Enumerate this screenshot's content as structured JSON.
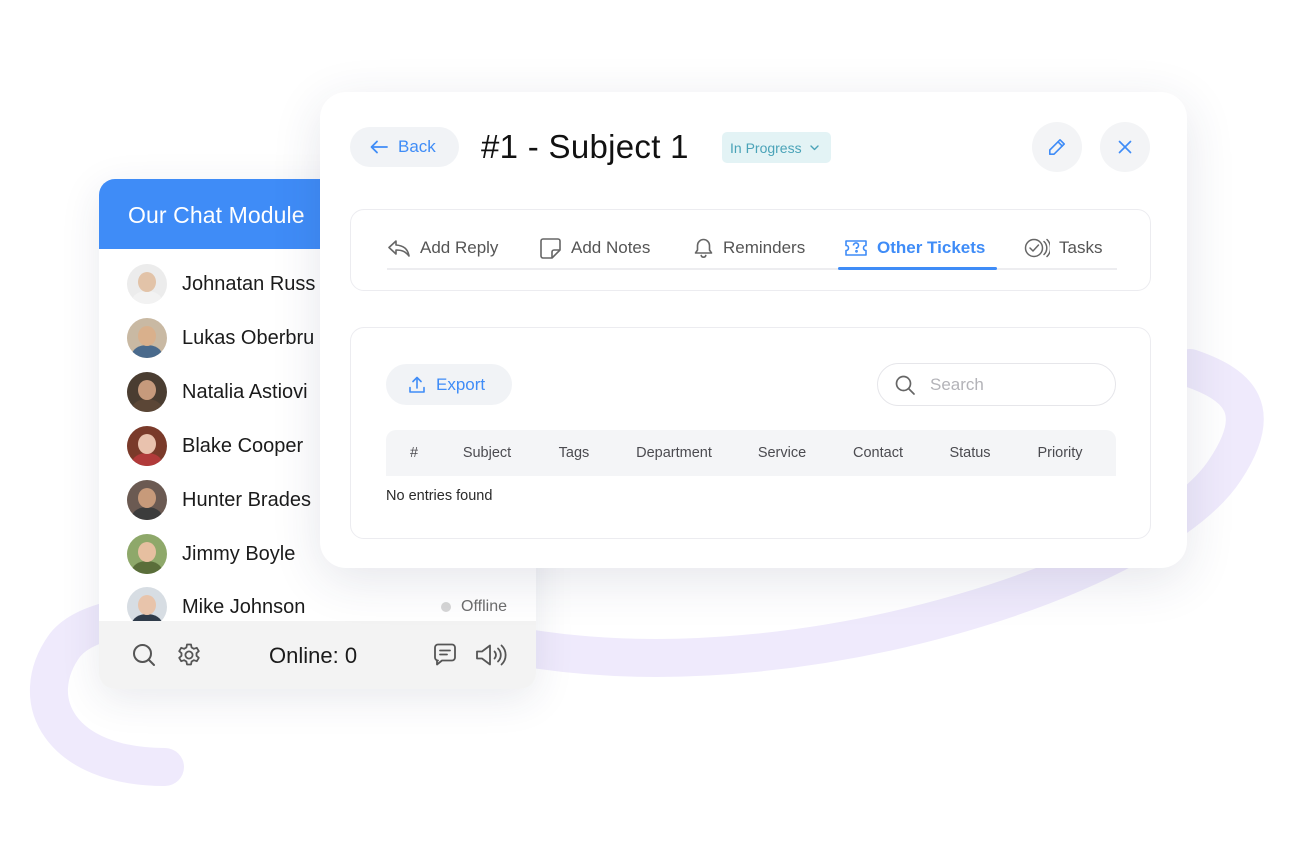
{
  "chat": {
    "title": "Our Chat Module",
    "contacts": [
      {
        "name": "Johnatan Russ",
        "skin": "#e2c3a8",
        "shirt": "#f2f2f2",
        "bg": "#ececec"
      },
      {
        "name": "Lukas Oberbru",
        "skin": "#d9b08c",
        "shirt": "#4a6a8c",
        "bg": "#c9b9a3"
      },
      {
        "name": "Natalia Astiovi",
        "skin": "#c69a7c",
        "shirt": "#5b4636",
        "bg": "#4a3d31"
      },
      {
        "name": "Blake Cooper",
        "skin": "#e9c2ae",
        "shirt": "#b13a3a",
        "bg": "#7a3a2a"
      },
      {
        "name": "Hunter Brades",
        "skin": "#c79a7a",
        "shirt": "#3c3c3c",
        "bg": "#6b5a52"
      },
      {
        "name": "Jimmy Boyle",
        "skin": "#e6bfa0",
        "shirt": "#5a6e3a",
        "bg": "#8ea86a"
      },
      {
        "name": "Mike Johnson",
        "skin": "#e8c4ab",
        "shirt": "#2f3b4a",
        "bg": "#d7dde3",
        "status": "Offline"
      }
    ],
    "footer": {
      "online_label": "Online: 0",
      "icons": [
        "search-icon",
        "gear-icon",
        "chat-bubble-icon",
        "speaker-icon"
      ]
    }
  },
  "ticket": {
    "back_label": "Back",
    "title": "#1 - Subject 1",
    "status": "In Progress",
    "tabs": [
      {
        "label": "Add Reply",
        "icon": "reply-icon"
      },
      {
        "label": "Add Notes",
        "icon": "note-icon"
      },
      {
        "label": "Reminders",
        "icon": "bell-icon"
      },
      {
        "label": "Other Tickets",
        "icon": "ticket-icon",
        "active": true
      },
      {
        "label": "Tasks",
        "icon": "task-check-icon"
      }
    ],
    "export_label": "Export",
    "search_placeholder": "Search",
    "columns": [
      "#",
      "Subject",
      "Tags",
      "Department",
      "Service",
      "Contact",
      "Status",
      "Priority"
    ],
    "empty_message": "No entries found"
  },
  "colors": {
    "accent": "#3f8cf7",
    "status_pill_bg": "#e3f3f5",
    "status_pill_text": "#4aa3b8",
    "swoosh": "#efeafc",
    "offline_dot": "#d6d6d6"
  }
}
